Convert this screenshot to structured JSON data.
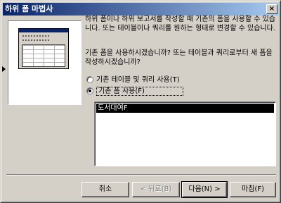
{
  "window": {
    "title": "하위 폼 마법사"
  },
  "description": {
    "intro": "하위 폼이나 하위 보고서를 작성할 때 기존의 폼을 사용할 수 있습니다. 또는 테이블이나 쿼리를 원하는 형태로 변경할 수 있습니다.",
    "question": "기존 폼을 사용하시겠습니까? 또는 테이블과 쿼리로부터 새 폼을 작성하시겠습니까?"
  },
  "options": [
    {
      "label": "기존 테이블 및 쿼리 사용(T)",
      "checked": false
    },
    {
      "label": "기존 폼 사용(F)",
      "checked": true
    }
  ],
  "form_list": {
    "items": [
      "도서대여F"
    ],
    "selected": "도서대여F"
  },
  "buttons": {
    "cancel": "취소",
    "back": "< 뒤로(B)",
    "next": "다음(N) >",
    "finish": "마침(F)"
  }
}
